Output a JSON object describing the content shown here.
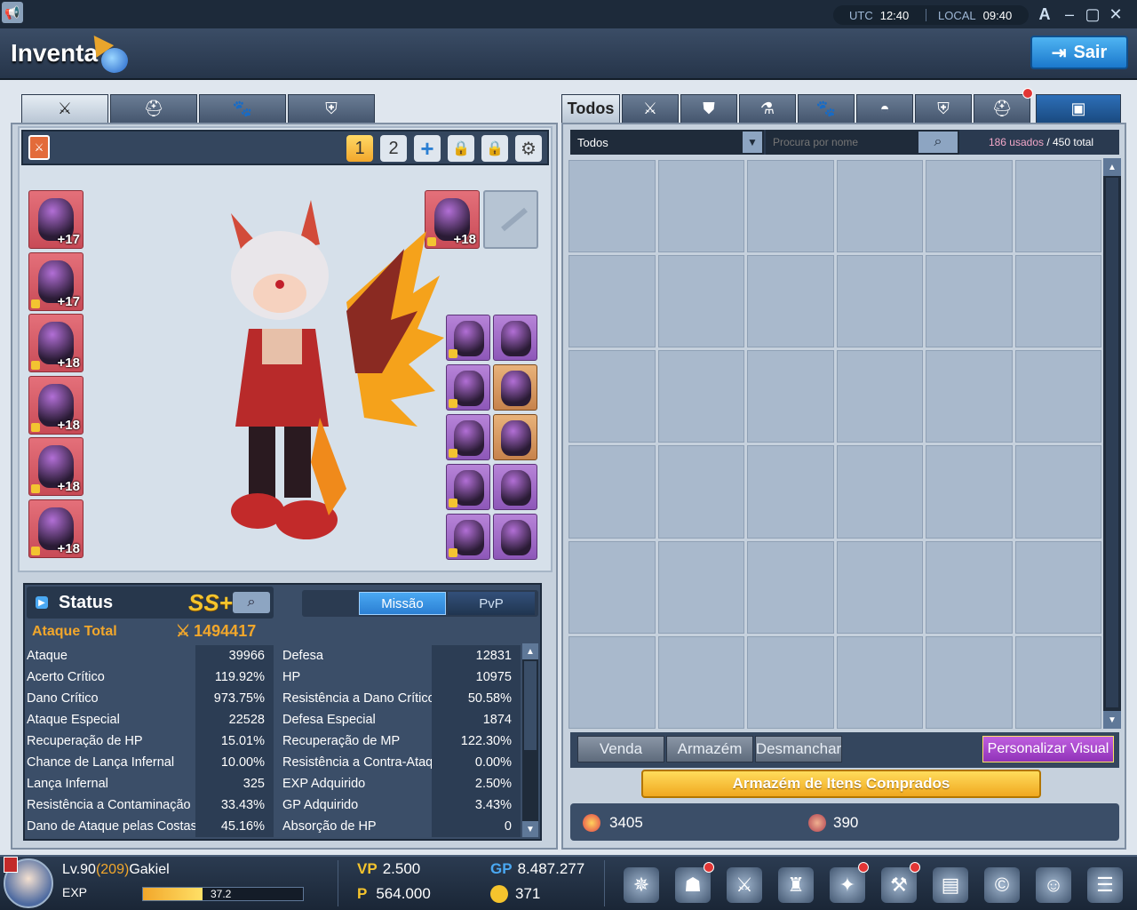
{
  "window": {
    "utc_label": "UTC",
    "utc_time": "12:40",
    "local_label": "LOCAL",
    "local_time": "09:40",
    "font_btn": "A",
    "title": "Inventa",
    "exit_label": "Sair"
  },
  "left_tabs": [
    {
      "icon": "sword-icon"
    },
    {
      "icon": "helmet-icon"
    },
    {
      "icon": "paw-icon"
    },
    {
      "icon": "shield-icon"
    }
  ],
  "loadout": {
    "set1": "1",
    "set2": "2",
    "add": "+"
  },
  "equip_left": [
    {
      "level": "+17",
      "icon": "hair-icon"
    },
    {
      "level": "+17",
      "icon": "armor-top-icon"
    },
    {
      "level": "+18",
      "icon": "armor-bottom-icon"
    },
    {
      "level": "+18",
      "icon": "gloves-icon"
    },
    {
      "level": "+18",
      "icon": "boots-icon"
    },
    {
      "level": "+18",
      "icon": "cape-icon"
    }
  ],
  "equip_right_top": {
    "level": "+18",
    "icon": "wing-icon"
  },
  "accessories": [
    {
      "rarity": "purple",
      "icon": "horn-icon"
    },
    {
      "rarity": "purple",
      "icon": "ring-icon"
    },
    {
      "rarity": "purple",
      "icon": "mask-icon"
    },
    {
      "rarity": "orange",
      "icon": "earring-icon"
    },
    {
      "rarity": "purple",
      "icon": "wing-accessory-icon"
    },
    {
      "rarity": "orange",
      "icon": "bracelet-icon"
    },
    {
      "rarity": "purple",
      "icon": "shoulder-icon"
    },
    {
      "rarity": "purple",
      "icon": "crystal-icon"
    },
    {
      "rarity": "purple",
      "icon": "back-icon"
    },
    {
      "rarity": "purple",
      "icon": "emblem-icon"
    }
  ],
  "status": {
    "title": "Status",
    "grade": "SS+",
    "tab_mission": "Missão",
    "tab_pvp": "PvP",
    "total_label": "Ataque Total",
    "total_value": "1494417",
    "left": [
      {
        "label": "Ataque",
        "value": "39966"
      },
      {
        "label": "Acerto Crítico",
        "value": "119.92%"
      },
      {
        "label": "Dano Crítico",
        "value": "973.75%"
      },
      {
        "label": "Ataque Especial",
        "value": "22528"
      },
      {
        "label": "Recuperação de HP",
        "value": "15.01%"
      },
      {
        "label": "Chance de Lança Infernal",
        "value": "10.00%"
      },
      {
        "label": "Lança Infernal",
        "value": "325"
      },
      {
        "label": "Resistência a Contaminação",
        "value": "33.43%"
      },
      {
        "label": "Dano de Ataque pelas Costas",
        "value": "45.16%"
      }
    ],
    "right": [
      {
        "label": "Defesa",
        "value": "12831"
      },
      {
        "label": "HP",
        "value": "10975"
      },
      {
        "label": "Resistência a Dano Crítico",
        "value": "50.58%"
      },
      {
        "label": "Defesa Especial",
        "value": "1874"
      },
      {
        "label": "Recuperação de MP",
        "value": "122.30%"
      },
      {
        "label": "Resistência a Contra-Ataque",
        "value": "0.00%"
      },
      {
        "label": "EXP Adquirido",
        "value": "2.50%"
      },
      {
        "label": "GP Adquirido",
        "value": "3.43%"
      },
      {
        "label": "Absorção de HP",
        "value": "0"
      }
    ]
  },
  "inventory": {
    "tab_all": "Todos",
    "tabs": [
      {
        "icon": "sword-icon"
      },
      {
        "icon": "armor-icon"
      },
      {
        "icon": "potion-icon"
      },
      {
        "icon": "paw-icon"
      },
      {
        "icon": "bag-icon"
      },
      {
        "icon": "shield-icon"
      },
      {
        "icon": "helmet-icon"
      }
    ],
    "filter": "Todos",
    "search_placeholder": "Procura por nome",
    "used": "186 usados",
    "total": " / 450 total",
    "btn_sell": "Venda",
    "btn_storage": "Armazém",
    "btn_dismantle": "Desmanchar",
    "btn_visual": "Personalizar Visual",
    "btn_purchased": "Armazém de Itens Comprados",
    "currency1": "3405",
    "currency2": "390"
  },
  "hud": {
    "level_prefix": "Lv.90",
    "level_extra": "(209)",
    "name": "Gakiel",
    "exp_label": "EXP",
    "exp_value": "37.2",
    "exp_fraction": 0.372,
    "vp_label": "VP",
    "vp_value": "2.500",
    "p_label": "P",
    "p_value": "564.000",
    "gp_label": "GP",
    "gp_value": "8.487.277",
    "coin_value": "371",
    "menu_icons": [
      "compass-icon",
      "robot-icon",
      "swords-icon",
      "castle-icon",
      "gift-icon",
      "hammer-icon",
      "book-icon",
      "c-shield-icon",
      "angel-icon",
      "menu-icon"
    ]
  },
  "colors": {
    "accent_orange": "#f2a72b",
    "tab_blue": "#2b7fd3",
    "purple": "#a240c9",
    "yellow_btn": "#f3c431"
  }
}
